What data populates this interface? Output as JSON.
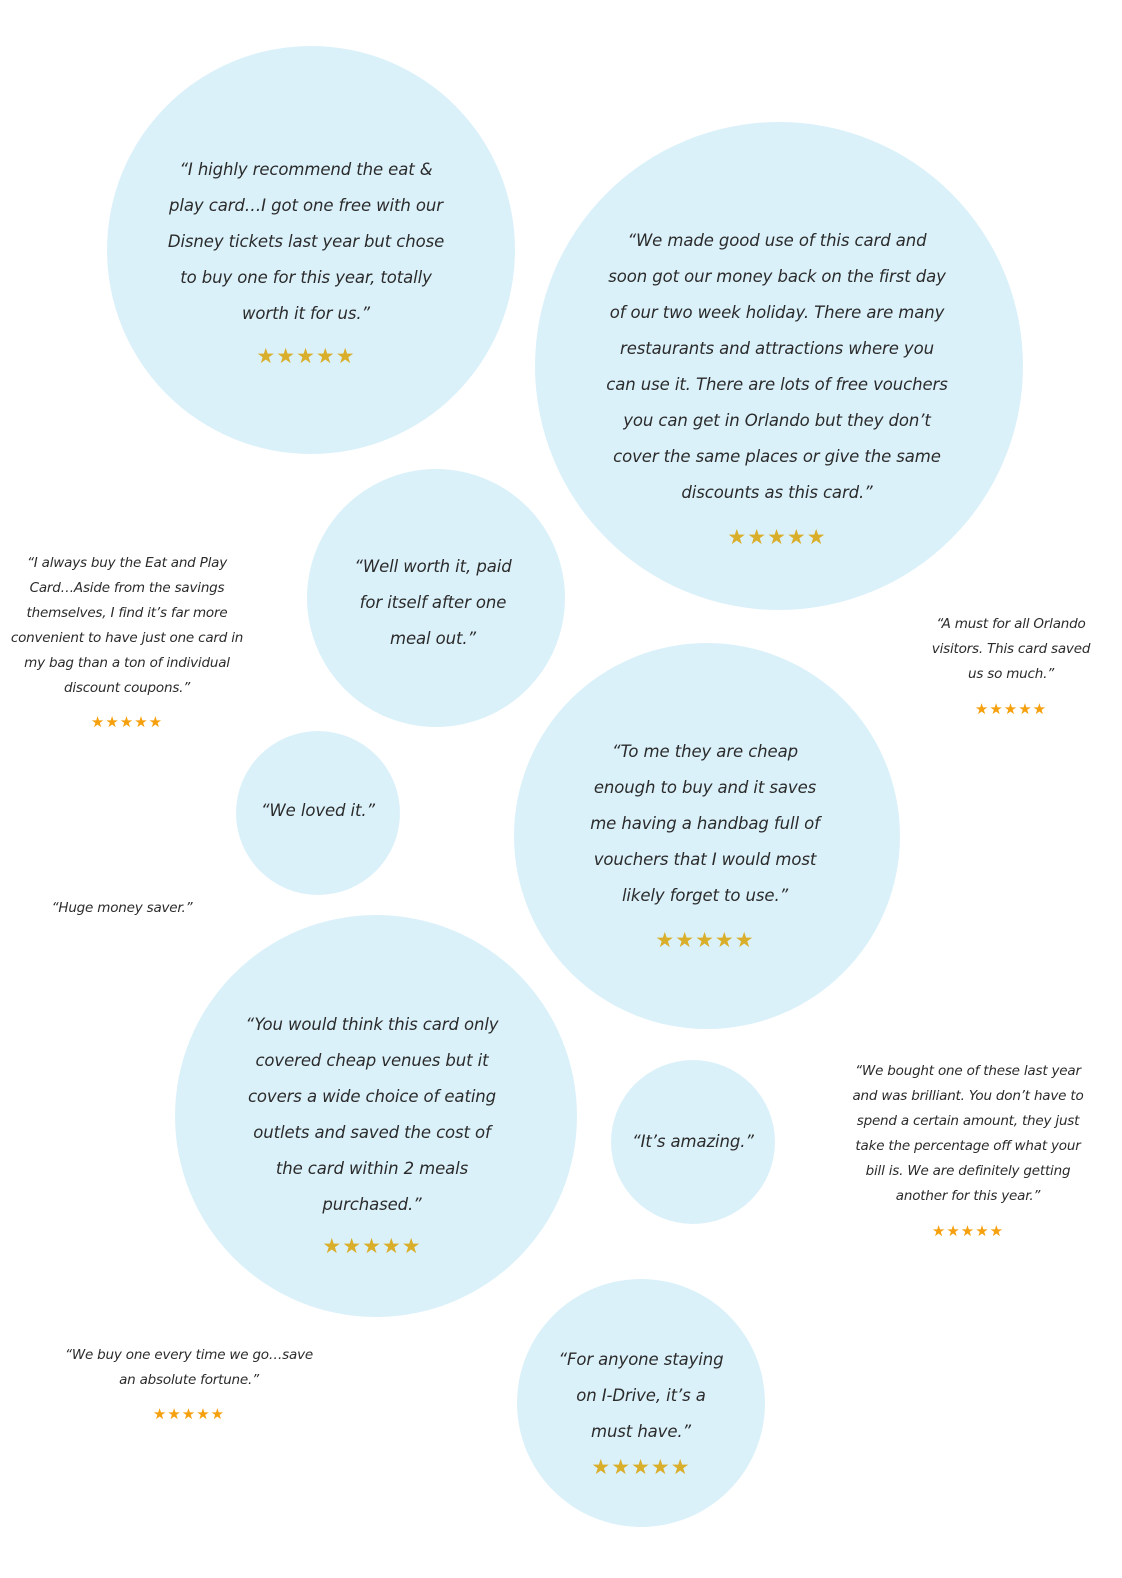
{
  "colors": {
    "circle_bg": "#dbf1fa",
    "star_in_circle": "#d9ae2a",
    "star_outside": "#f5a00c",
    "text": "#2b2b2b"
  },
  "star_icon": "★",
  "testimonials": [
    {
      "style": "circle",
      "rating": 5,
      "lines": [
        "“I highly recommend the eat &",
        "play card…I got one free with our",
        "Disney tickets last year but chose",
        "to buy one for this year, totally",
        "worth it for us.”"
      ]
    },
    {
      "style": "circle",
      "rating": 5,
      "lines": [
        "“We made good use of this card and",
        "soon got our money back on the first day",
        "of our two week holiday. There are many",
        "restaurants and attractions where you",
        "can use it. There are lots of free vouchers",
        "you can get in Orlando but they don’t",
        "cover the same places or give the same",
        "discounts as this card.”"
      ]
    },
    {
      "style": "circle",
      "rating": null,
      "lines": [
        "“Well worth it, paid",
        "for itself after one",
        "meal out.”"
      ]
    },
    {
      "style": "circle",
      "rating": null,
      "lines": [
        "“We loved it.”"
      ]
    },
    {
      "style": "circle",
      "rating": 5,
      "lines": [
        "“To me they are cheap",
        "enough to buy and it saves",
        "me having a handbag full of",
        "vouchers that I would most",
        "likely forget to use.”"
      ]
    },
    {
      "style": "circle",
      "rating": 5,
      "lines": [
        "“You would think this card only",
        "covered cheap venues but it",
        "covers a wide choice of eating",
        "outlets and saved the cost of",
        "the card within 2 meals",
        "purchased.”"
      ]
    },
    {
      "style": "circle",
      "rating": null,
      "lines": [
        "“It’s amazing.”"
      ]
    },
    {
      "style": "circle",
      "rating": 5,
      "lines": [
        "“For anyone staying",
        "on I-Drive, it’s a",
        "must have.”"
      ]
    },
    {
      "style": "plain",
      "rating": 5,
      "lines": [
        "“I always buy the Eat and Play",
        "Card…Aside from the savings",
        "themselves, I find it’s far more",
        "convenient to have just one card in",
        "my bag than a ton of individual",
        "discount coupons.”"
      ]
    },
    {
      "style": "plain",
      "rating": 5,
      "lines": [
        "“A must for all Orlando",
        "visitors. This card saved",
        "us so much.”"
      ]
    },
    {
      "style": "plain",
      "rating": null,
      "lines": [
        "“Huge money saver.”"
      ]
    },
    {
      "style": "plain",
      "rating": 5,
      "lines": [
        "“We bought one of these last year",
        "and was brilliant. You don’t have to",
        "spend a certain amount, they just",
        "take the percentage off what your",
        "bill is. We are definitely getting",
        "another for this year.”"
      ]
    },
    {
      "style": "plain",
      "rating": 5,
      "lines": [
        "“We buy one every time we go…save",
        "an absolute fortune.”"
      ]
    }
  ]
}
